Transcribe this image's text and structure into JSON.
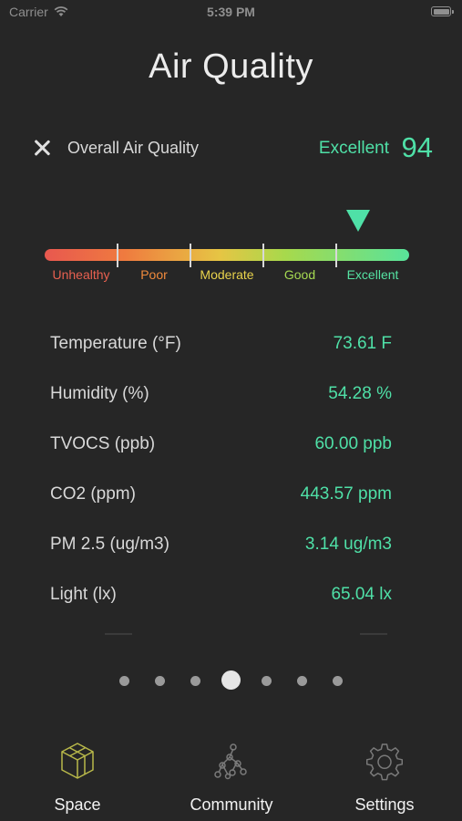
{
  "status_bar": {
    "carrier": "Carrier",
    "time": "5:39 PM"
  },
  "page": {
    "title": "Air Quality"
  },
  "overall": {
    "label": "Overall Air Quality",
    "rating": "Excellent",
    "score": "94"
  },
  "scale": {
    "labels": [
      {
        "text": "Unhealthy",
        "color": "#e86050"
      },
      {
        "text": "Poor",
        "color": "#f08a3c"
      },
      {
        "text": "Moderate",
        "color": "#e9d34c"
      },
      {
        "text": "Good",
        "color": "#a6da52"
      },
      {
        "text": "Excellent",
        "color": "#55e3a2"
      }
    ],
    "pointer_fraction": 0.86
  },
  "metrics": [
    {
      "name": "Temperature (°F)",
      "value": "73.61 F"
    },
    {
      "name": "Humidity (%)",
      "value": "54.28 %"
    },
    {
      "name": "TVOCS (ppb)",
      "value": "60.00 ppb"
    },
    {
      "name": "CO2 (ppm)",
      "value": "443.57 ppm"
    },
    {
      "name": "PM 2.5 (ug/m3)",
      "value": "3.14 ug/m3"
    },
    {
      "name": "Light (lx)",
      "value": "65.04 lx"
    }
  ],
  "pagination": {
    "count": 7,
    "active_index": 3
  },
  "tabs": [
    {
      "label": "Space",
      "icon": "cube-icon",
      "active": true
    },
    {
      "label": "Community",
      "icon": "network-icon",
      "active": false
    },
    {
      "label": "Settings",
      "icon": "gear-icon",
      "active": false
    }
  ],
  "colors": {
    "background": "#262626",
    "accent": "#4fe0a7",
    "active_tab_icon": "#b9b94a",
    "inactive_tab_icon": "#7a7a7a"
  }
}
